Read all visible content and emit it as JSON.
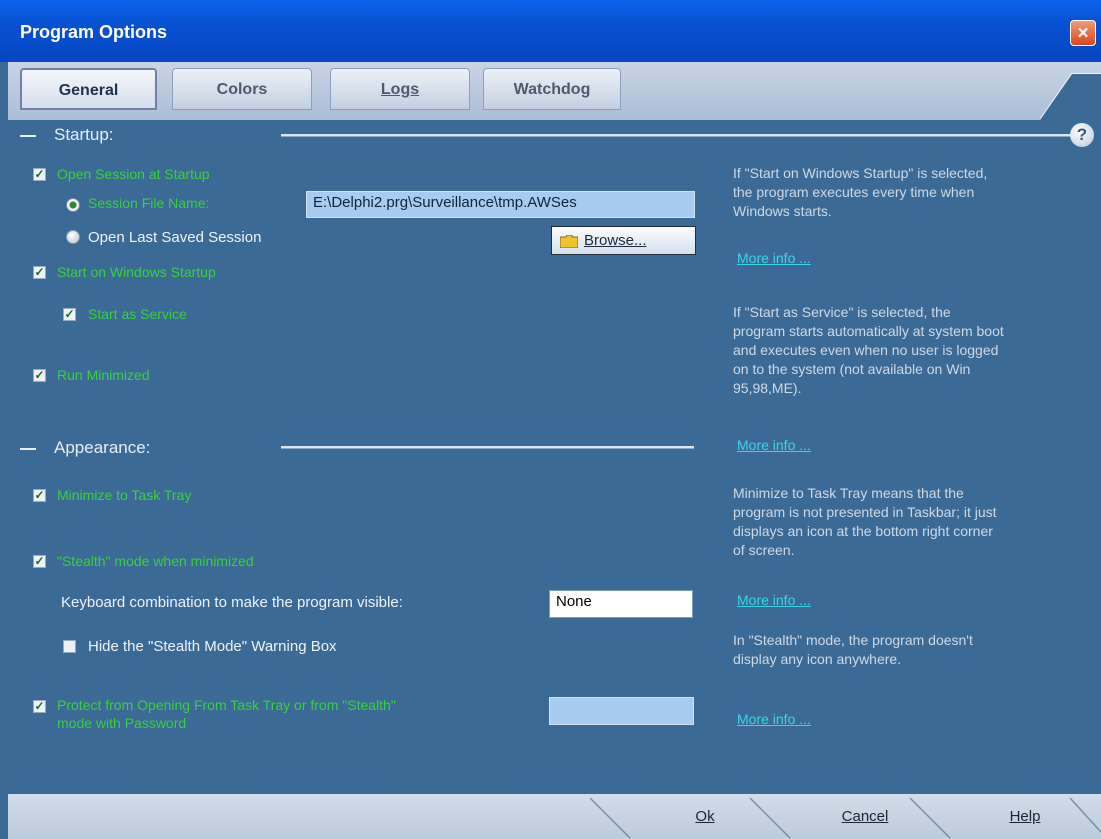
{
  "window": {
    "title": "Program Options",
    "close_label": "×"
  },
  "tabs": [
    {
      "label": "General",
      "active": true
    },
    {
      "label": "Colors",
      "active": false
    },
    {
      "label": "Logs",
      "active": false
    },
    {
      "label": "Watchdog",
      "active": false
    }
  ],
  "startup": {
    "heading": "Startup:",
    "help_glyph": "?",
    "open_session": {
      "label": "Open Session at Startup",
      "checked": true
    },
    "session_file": {
      "label": "Session File Name:",
      "selected": true,
      "value": "E:\\Delphi2.prg\\Surveillance\\tmp.AWSes"
    },
    "open_last": {
      "label": "Open Last Saved Session",
      "selected": false
    },
    "browse_label": "Browse...",
    "start_windows": {
      "label": "Start on Windows Startup",
      "checked": true
    },
    "start_service": {
      "label": "Start as Service",
      "checked": true
    },
    "run_minimized": {
      "label": "Run Minimized",
      "checked": true
    }
  },
  "appearance": {
    "heading": "Appearance:",
    "minimize_tray": {
      "label": "Minimize to Task Tray",
      "checked": true
    },
    "stealth": {
      "label": "\"Stealth\" mode when minimized",
      "checked": true
    },
    "keyboard": {
      "label": "Keyboard combination to make the program visible:",
      "value": "None"
    },
    "hide_warning": {
      "label": "Hide the \"Stealth Mode\" Warning Box",
      "checked": false
    },
    "protect": {
      "label_line1": "Protect from Opening From Task Tray or from \"Stealth\"",
      "label_line2": "mode with Password",
      "checked": true,
      "value": ""
    }
  },
  "info": {
    "p1": [
      "If \"Start on Windows Startup\" is selected,",
      "the program executes every time when",
      "Windows starts."
    ],
    "p2": [
      "If \"Start as Service\" is selected, the",
      "program starts automatically at system boot",
      "and executes even when no user is logged",
      "on to the system (not available on Win",
      "95,98,ME)."
    ],
    "p3": [
      "Minimize to Task Tray means that the",
      "program is not presented in Taskbar; it just",
      "displays an icon at the bottom right corner",
      "of screen."
    ],
    "p4": [
      "In \"Stealth\" mode, the program doesn't",
      "display any icon anywhere."
    ],
    "more_info": "More info ..."
  },
  "buttons": {
    "ok": "Ok",
    "cancel": "Cancel",
    "help": "Help"
  },
  "colors": {
    "client_bg": "#3c6a96",
    "title_bg": "#0852d4",
    "green_label": "#34d23c",
    "link": "#38d6e8"
  }
}
